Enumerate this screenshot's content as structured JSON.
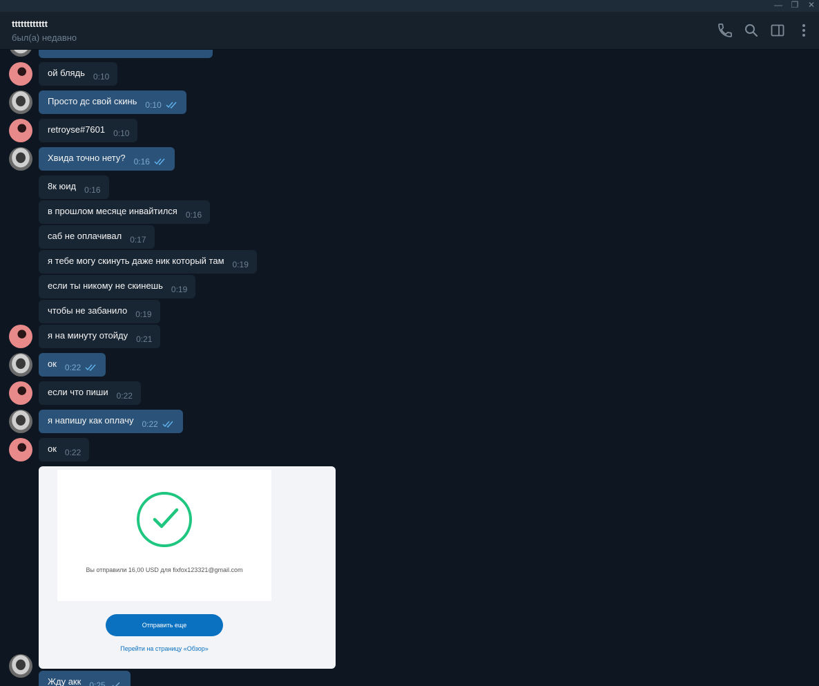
{
  "window": {
    "controls": [
      "—",
      "❐",
      "✕"
    ]
  },
  "header": {
    "name": "tttttttttttt",
    "status": "был(а) недавно",
    "icons": [
      "phone-icon",
      "search-icon",
      "sidebar-toggle-icon",
      "more-vertical-icon"
    ]
  },
  "messages": [
    {
      "text": "ой блядь",
      "time": "0:10",
      "dir": "in"
    },
    {
      "text": "Просто дс свой скинь",
      "time": "0:10",
      "dir": "out"
    },
    {
      "text": "retroyse#7601",
      "time": "0:10",
      "dir": "in"
    },
    {
      "text": "Хвида точно нету?",
      "time": "0:16",
      "dir": "out"
    },
    {
      "text": "8к юид",
      "time": "0:16",
      "dir": "in"
    },
    {
      "text": "в прошлом месяце инвайтился",
      "time": "0:16",
      "dir": "in"
    },
    {
      "text": "саб не оплачивал",
      "time": "0:17",
      "dir": "in"
    },
    {
      "text": "я тебе могу скинуть даже ник который там",
      "time": "0:19",
      "dir": "in"
    },
    {
      "text": "если ты никому не скинешь",
      "time": "0:19",
      "dir": "in"
    },
    {
      "text": "чтобы не забанило",
      "time": "0:19",
      "dir": "in"
    },
    {
      "text": "я на минуту отойду",
      "time": "0:21",
      "dir": "in"
    },
    {
      "text": "ок",
      "time": "0:22",
      "dir": "out"
    },
    {
      "text": "если что пиши",
      "time": "0:22",
      "dir": "in"
    },
    {
      "text": "я напишу как оплачу",
      "time": "0:22",
      "dir": "out"
    },
    {
      "text": "ок",
      "time": "0:22",
      "dir": "in"
    },
    {
      "text": "Жду акк",
      "time": "0:25",
      "dir": "out"
    }
  ],
  "photo": {
    "sent_text": "Вы отправили 16,00 USD для fixfox123321@gmail.com",
    "button": "Отправить еще",
    "link": "Перейти на страницу «Обзор»",
    "colors": {
      "check": "#1fc67f",
      "button": "#0a70c0"
    }
  },
  "colors": {
    "background": "#0e1621",
    "header": "#17212b",
    "bubble_in": "#182533",
    "bubble_out": "#2b5278",
    "read_checks": "#5fb0ea"
  }
}
